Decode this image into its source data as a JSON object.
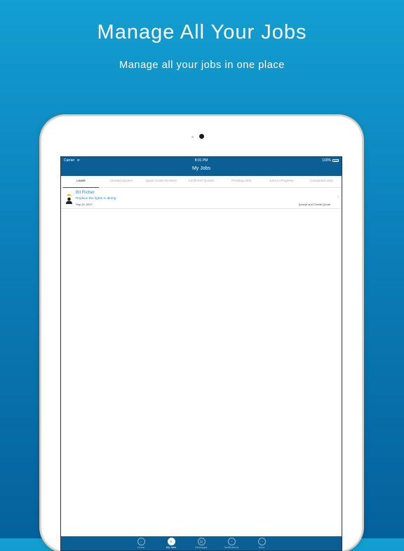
{
  "marketing": {
    "headline": "Manage All Your Jobs",
    "subheadline": "Manage all your jobs in one place"
  },
  "status_bar": {
    "carrier": "Carrier",
    "time": "8:01 PM",
    "battery": "100%"
  },
  "nav": {
    "title": "My Jobs"
  },
  "tabs": [
    {
      "label": "Leads",
      "active": true
    },
    {
      "label": "Created Quotes"
    },
    {
      "label": "Quote Under Revision"
    },
    {
      "label": "Confirmed Quotes"
    },
    {
      "label": "Pending Jobs"
    },
    {
      "label": "Jobs in Progress"
    },
    {
      "label": "Completed Jobs"
    }
  ],
  "leads": [
    {
      "name": "Bil  Richer",
      "description": "Replace the lights in dining",
      "date": "Sep 20, 2017",
      "action": "Accept and Create Quote"
    }
  ],
  "bottom_tabs": [
    {
      "label": "Home",
      "icon": "home-icon"
    },
    {
      "label": "My Jobs",
      "icon": "list-icon",
      "active": true
    },
    {
      "label": "Messages",
      "icon": "message-icon"
    },
    {
      "label": "Notifications",
      "icon": "bell-icon"
    },
    {
      "label": "More",
      "icon": "more-icon"
    }
  ],
  "colors": {
    "brand": "#0b5f94",
    "accent": "#1e8fcf"
  }
}
